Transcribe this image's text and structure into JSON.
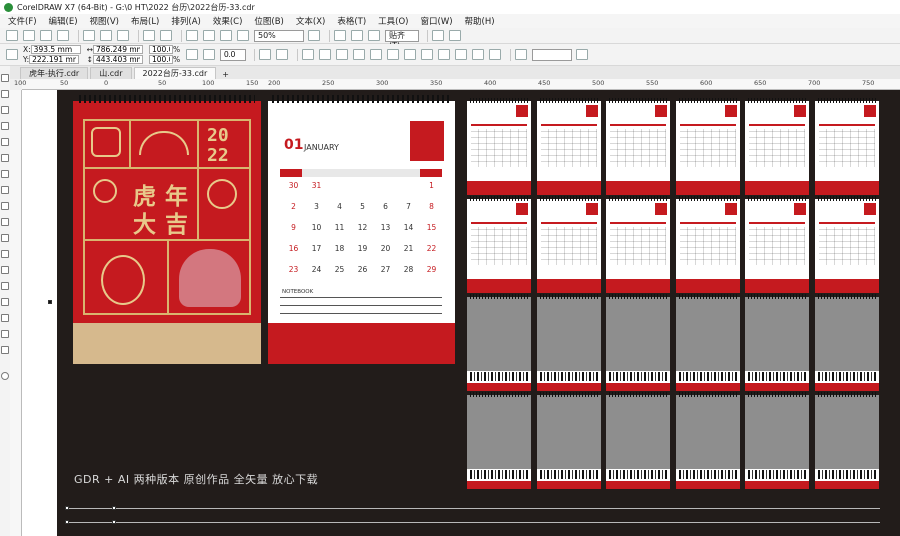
{
  "window": {
    "title": "CorelDRAW X7 (64-Bit) - G:\\0 HT\\2022 台历\\2022台历-33.cdr"
  },
  "menu": [
    "文件(F)",
    "编辑(E)",
    "视图(V)",
    "布局(L)",
    "排列(A)",
    "效果(C)",
    "位图(B)",
    "文本(X)",
    "表格(T)",
    "工具(O)",
    "窗口(W)",
    "帮助(H)"
  ],
  "toolbar": {
    "zoom": "50%",
    "snap_label": "贴齐(T)"
  },
  "properties": {
    "x_label": "X:",
    "x_value": "393.5 mm",
    "y_label": "Y:",
    "y_value": "222.191 mm",
    "w_value": "786.249 mm",
    "h_value": "443.403 mm",
    "scale_x": "100.0",
    "scale_y": "100.0",
    "percent": "%",
    "rotation": "0.0"
  },
  "tabs": [
    "虎年-执行.cdr",
    "山.cdr",
    "2022台历-33.cdr"
  ],
  "ruler_ticks": [
    "100",
    "50",
    "0",
    "50",
    "100",
    "150",
    "200",
    "250",
    "300",
    "350",
    "400",
    "450",
    "500",
    "550",
    "600",
    "650",
    "700",
    "750"
  ],
  "cover": {
    "chars": [
      "虎",
      "年",
      "大",
      "吉"
    ],
    "year_top": "20",
    "year_bottom": "22"
  },
  "page": {
    "month_num": "01",
    "month_name": "JANUARY",
    "days": [
      "30",
      "31",
      "",
      "",
      "",
      "",
      "1",
      "2",
      "3",
      "4",
      "5",
      "6",
      "7",
      "8",
      "9",
      "10",
      "11",
      "12",
      "13",
      "14",
      "15",
      "16",
      "17",
      "18",
      "19",
      "20",
      "21",
      "22",
      "23",
      "24",
      "25",
      "26",
      "27",
      "28",
      "29"
    ],
    "red_days": [
      "30",
      "31",
      "1",
      "2",
      "8",
      "9",
      "15",
      "16",
      "22",
      "23",
      "29"
    ],
    "notes_label": "NOTEBOOK"
  },
  "banner": "GDR + AI 两种版本 原创作品 全矢量 放心下载",
  "colors": {
    "red": "#c51a1f",
    "gold": "#d9b56f",
    "canvas": "#221c1a"
  }
}
